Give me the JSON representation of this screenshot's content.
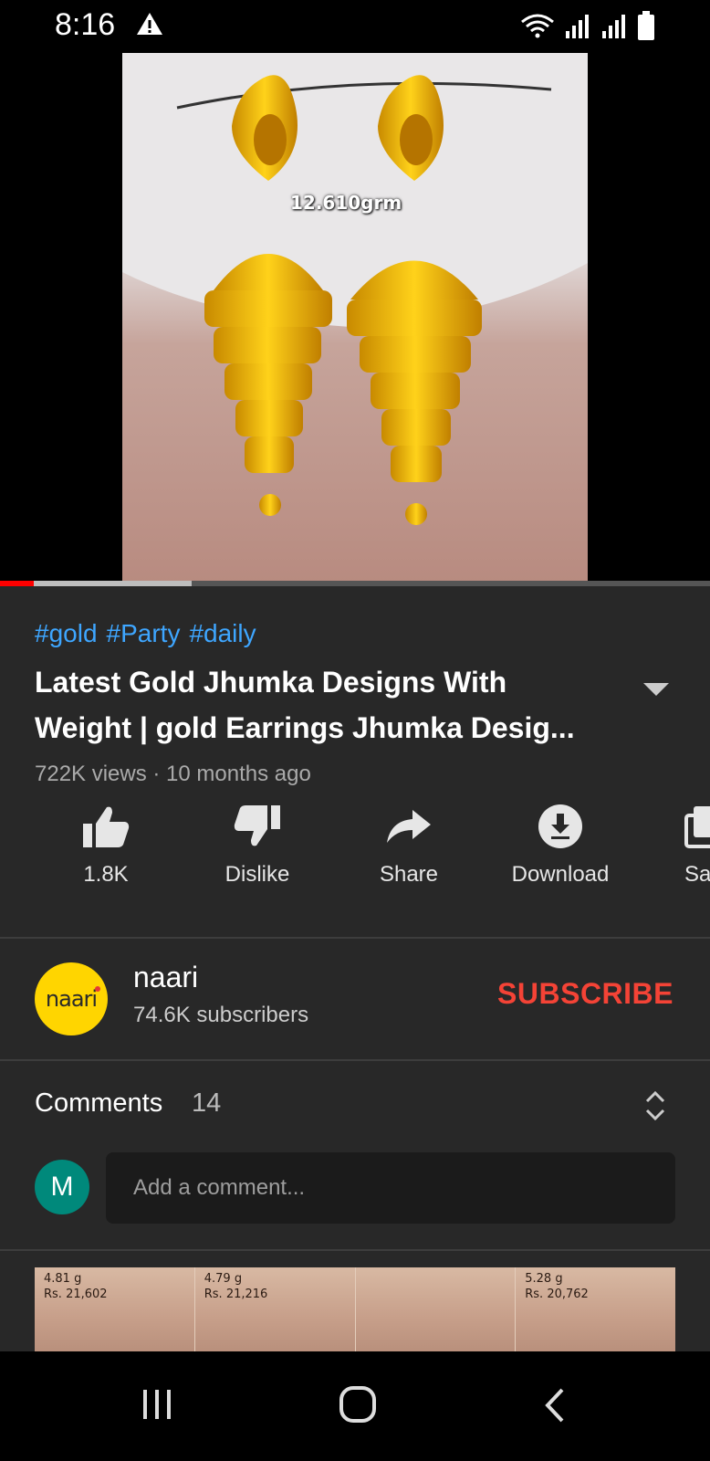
{
  "status_bar": {
    "time": "8:16"
  },
  "video": {
    "overlay_weight": "12.610grm",
    "progress": {
      "played_fraction": 0.047,
      "buffered_fraction": 0.27
    }
  },
  "details": {
    "hashtags": [
      "#gold",
      "#Party",
      "#daily"
    ],
    "title_line1": "Latest Gold Jhumka Designs With",
    "title_line2": "Weight | gold Earrings Jhumka Desig...",
    "meta": "722K views · 10 months ago"
  },
  "actions": {
    "like": "1.8K",
    "dislike": "Dislike",
    "share": "Share",
    "download": "Download",
    "save": "Sa"
  },
  "channel": {
    "logo_text": "naari",
    "name": "naari",
    "subscribers": "74.6K subscribers",
    "subscribe_label": "SUBSCRIBE"
  },
  "comments": {
    "label": "Comments",
    "count": "14",
    "user_initial": "M",
    "placeholder": "Add a comment..."
  },
  "next_preview": [
    {
      "weight": "4.81 g",
      "price": "Rs. 21,602"
    },
    {
      "weight": "4.79 g",
      "price": "Rs. 21,216"
    },
    {
      "weight": "",
      "price": ""
    },
    {
      "weight": "5.28 g",
      "price": "Rs. 20,762"
    }
  ],
  "colors": {
    "accent": "#f44336",
    "link": "#3ea6ff",
    "panel": "#282828",
    "progress": "#ff0000"
  }
}
